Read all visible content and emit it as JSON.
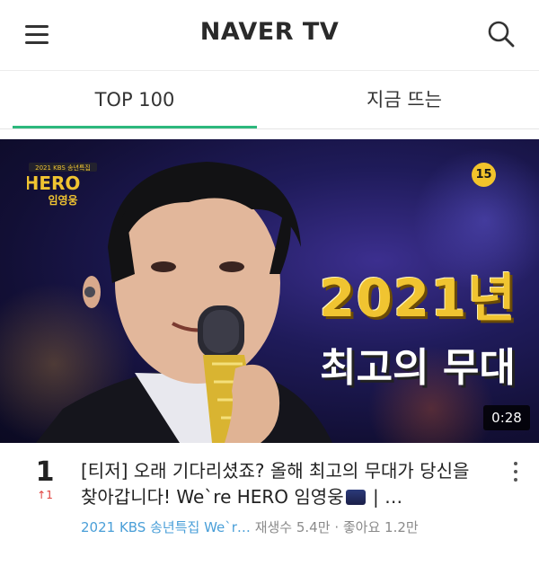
{
  "header": {
    "logo_text": "NAVER TV",
    "menu_icon": "hamburger-menu-icon",
    "search_icon": "search-icon"
  },
  "tabs": [
    {
      "label": "TOP 100",
      "active": true
    },
    {
      "label": "지금 뜨는",
      "active": false
    }
  ],
  "colors": {
    "accent": "#2db87d",
    "channel_link": "#4a9fd8",
    "rank_up": "#e0403c",
    "age_badge": "#f2c32b"
  },
  "video": {
    "thumbnail": {
      "overlay_year": "2021년",
      "overlay_sub": "최고의 무대",
      "age_rating": "15",
      "duration": "0:28"
    },
    "rank": "1",
    "rank_change": "↑1",
    "title_part1": "[티저] 오래 기다리셨죠? 올해 최고의 무대가 당신을 찾아갑니다! We`re HERO 임영웅",
    "title_part2": " | …",
    "channel": "2021 KBS 송년특집 We`r…",
    "views": "재생수 5.4만",
    "separator": "·",
    "likes": "좋아요 1.2만"
  }
}
